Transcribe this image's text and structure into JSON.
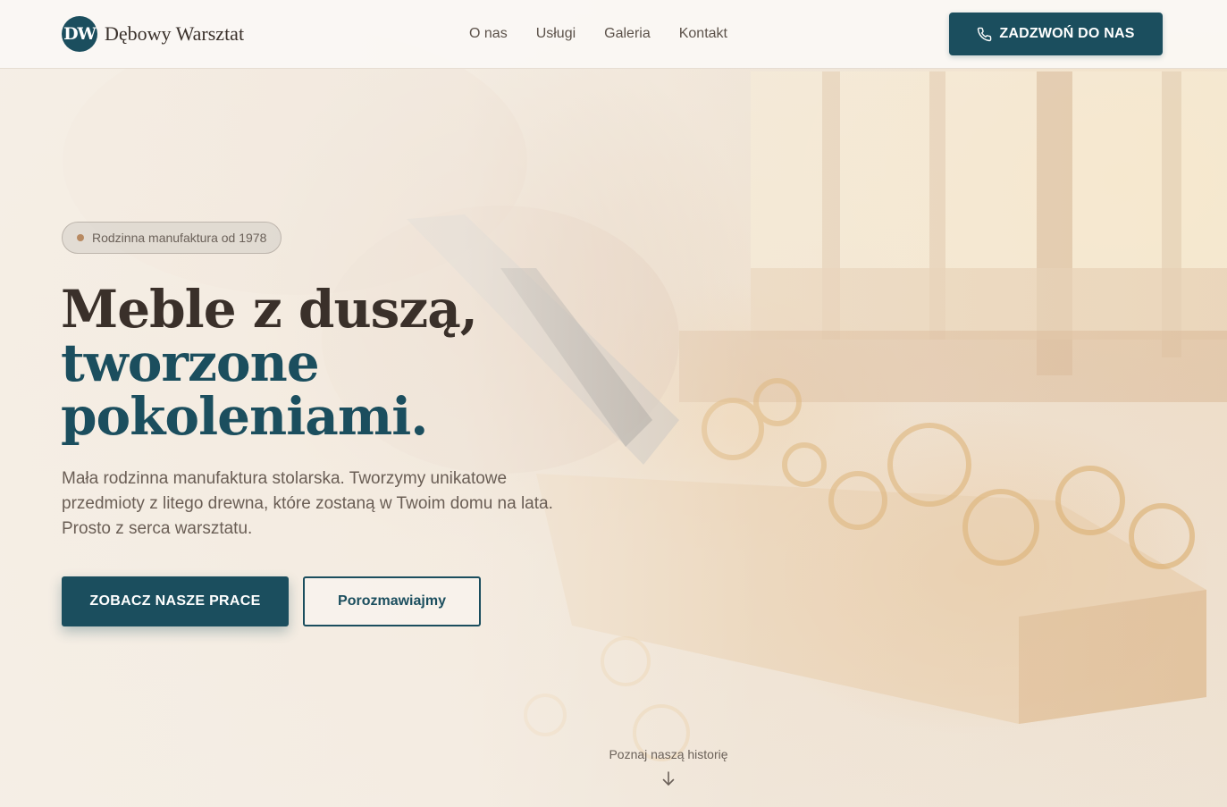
{
  "header": {
    "logo_mark": "DW",
    "logo_text": "Dębowy Warsztat",
    "nav": [
      {
        "label": "O nas"
      },
      {
        "label": "Usługi"
      },
      {
        "label": "Galeria"
      },
      {
        "label": "Kontakt"
      }
    ],
    "call_button": {
      "label": "ZADZWOŃ DO NAS",
      "icon": "phone-icon"
    }
  },
  "hero": {
    "badge": "Rodzinna manufaktura od 1978",
    "headline_line1": "Meble z duszą,",
    "headline_line2": "tworzone",
    "headline_line3": "pokoleniami.",
    "lead": "Mała rodzinna manufaktura stolarska. Tworzymy unikatowe przedmioty z litego drewna, które zostaną w Twoim domu na lata. Prosto z serca warsztatu.",
    "primary_button": "ZOBACZ NASZE PRACE",
    "secondary_button": "Porozmawiajmy",
    "scroll_hint": "Poznaj naszą historię",
    "scroll_icon": "arrow-down-icon"
  },
  "colors": {
    "brand": "#1b4e5e",
    "text_dark": "#3a302a",
    "text_muted": "#6a5e55",
    "accent_dot": "#b88a62"
  }
}
